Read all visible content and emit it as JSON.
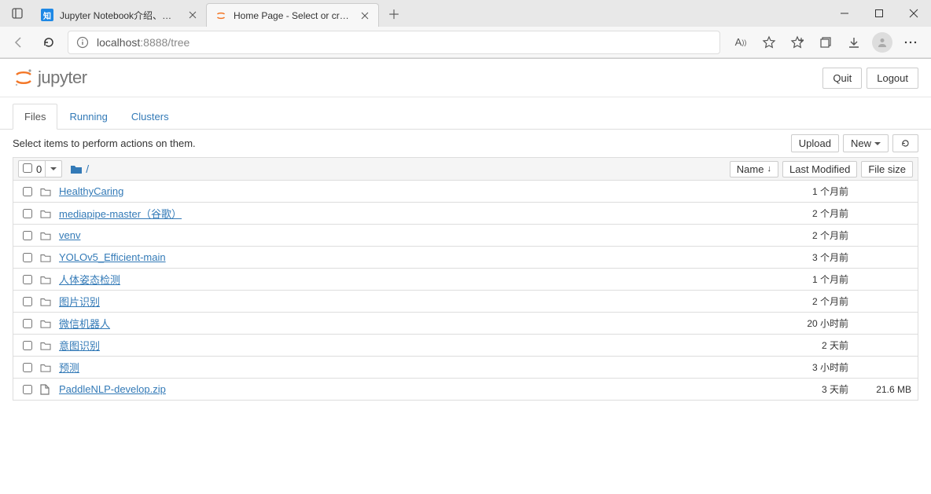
{
  "browser": {
    "tabs": [
      {
        "title": "Jupyter Notebook介绍、安装及",
        "favicon_bg": "#1e88e5",
        "favicon_text": "知",
        "active": false
      },
      {
        "title": "Home Page - Select or create a n",
        "favicon_bg": "#fff",
        "favicon_text": "",
        "active": true
      }
    ],
    "url_host": "localhost",
    "url_rest": ":8888/tree"
  },
  "header": {
    "logo_text": "jupyter",
    "quit": "Quit",
    "logout": "Logout"
  },
  "tabs": {
    "files": "Files",
    "running": "Running",
    "clusters": "Clusters"
  },
  "toolbar": {
    "hint": "Select items to perform actions on them.",
    "upload": "Upload",
    "new": "New",
    "selected_count": "0",
    "breadcrumb_root": "/"
  },
  "columns": {
    "name": "Name",
    "modified": "Last Modified",
    "size": "File size"
  },
  "files": [
    {
      "name": "HealthyCaring",
      "type": "folder",
      "modified": "1 个月前",
      "size": ""
    },
    {
      "name": "mediapipe-master（谷歌）",
      "type": "folder",
      "modified": "2 个月前",
      "size": ""
    },
    {
      "name": "venv",
      "type": "folder",
      "modified": "2 个月前",
      "size": ""
    },
    {
      "name": "YOLOv5_Efficient-main",
      "type": "folder",
      "modified": "3 个月前",
      "size": ""
    },
    {
      "name": "人体姿态检测",
      "type": "folder",
      "modified": "1 个月前",
      "size": ""
    },
    {
      "name": "图片识别",
      "type": "folder",
      "modified": "2 个月前",
      "size": ""
    },
    {
      "name": "微信机器人",
      "type": "folder",
      "modified": "20 小时前",
      "size": ""
    },
    {
      "name": "意图识别",
      "type": "folder",
      "modified": "2 天前",
      "size": ""
    },
    {
      "name": "预测",
      "type": "folder",
      "modified": "3 小时前",
      "size": ""
    },
    {
      "name": "PaddleNLP-develop.zip",
      "type": "file",
      "modified": "3 天前",
      "size": "21.6 MB"
    }
  ]
}
